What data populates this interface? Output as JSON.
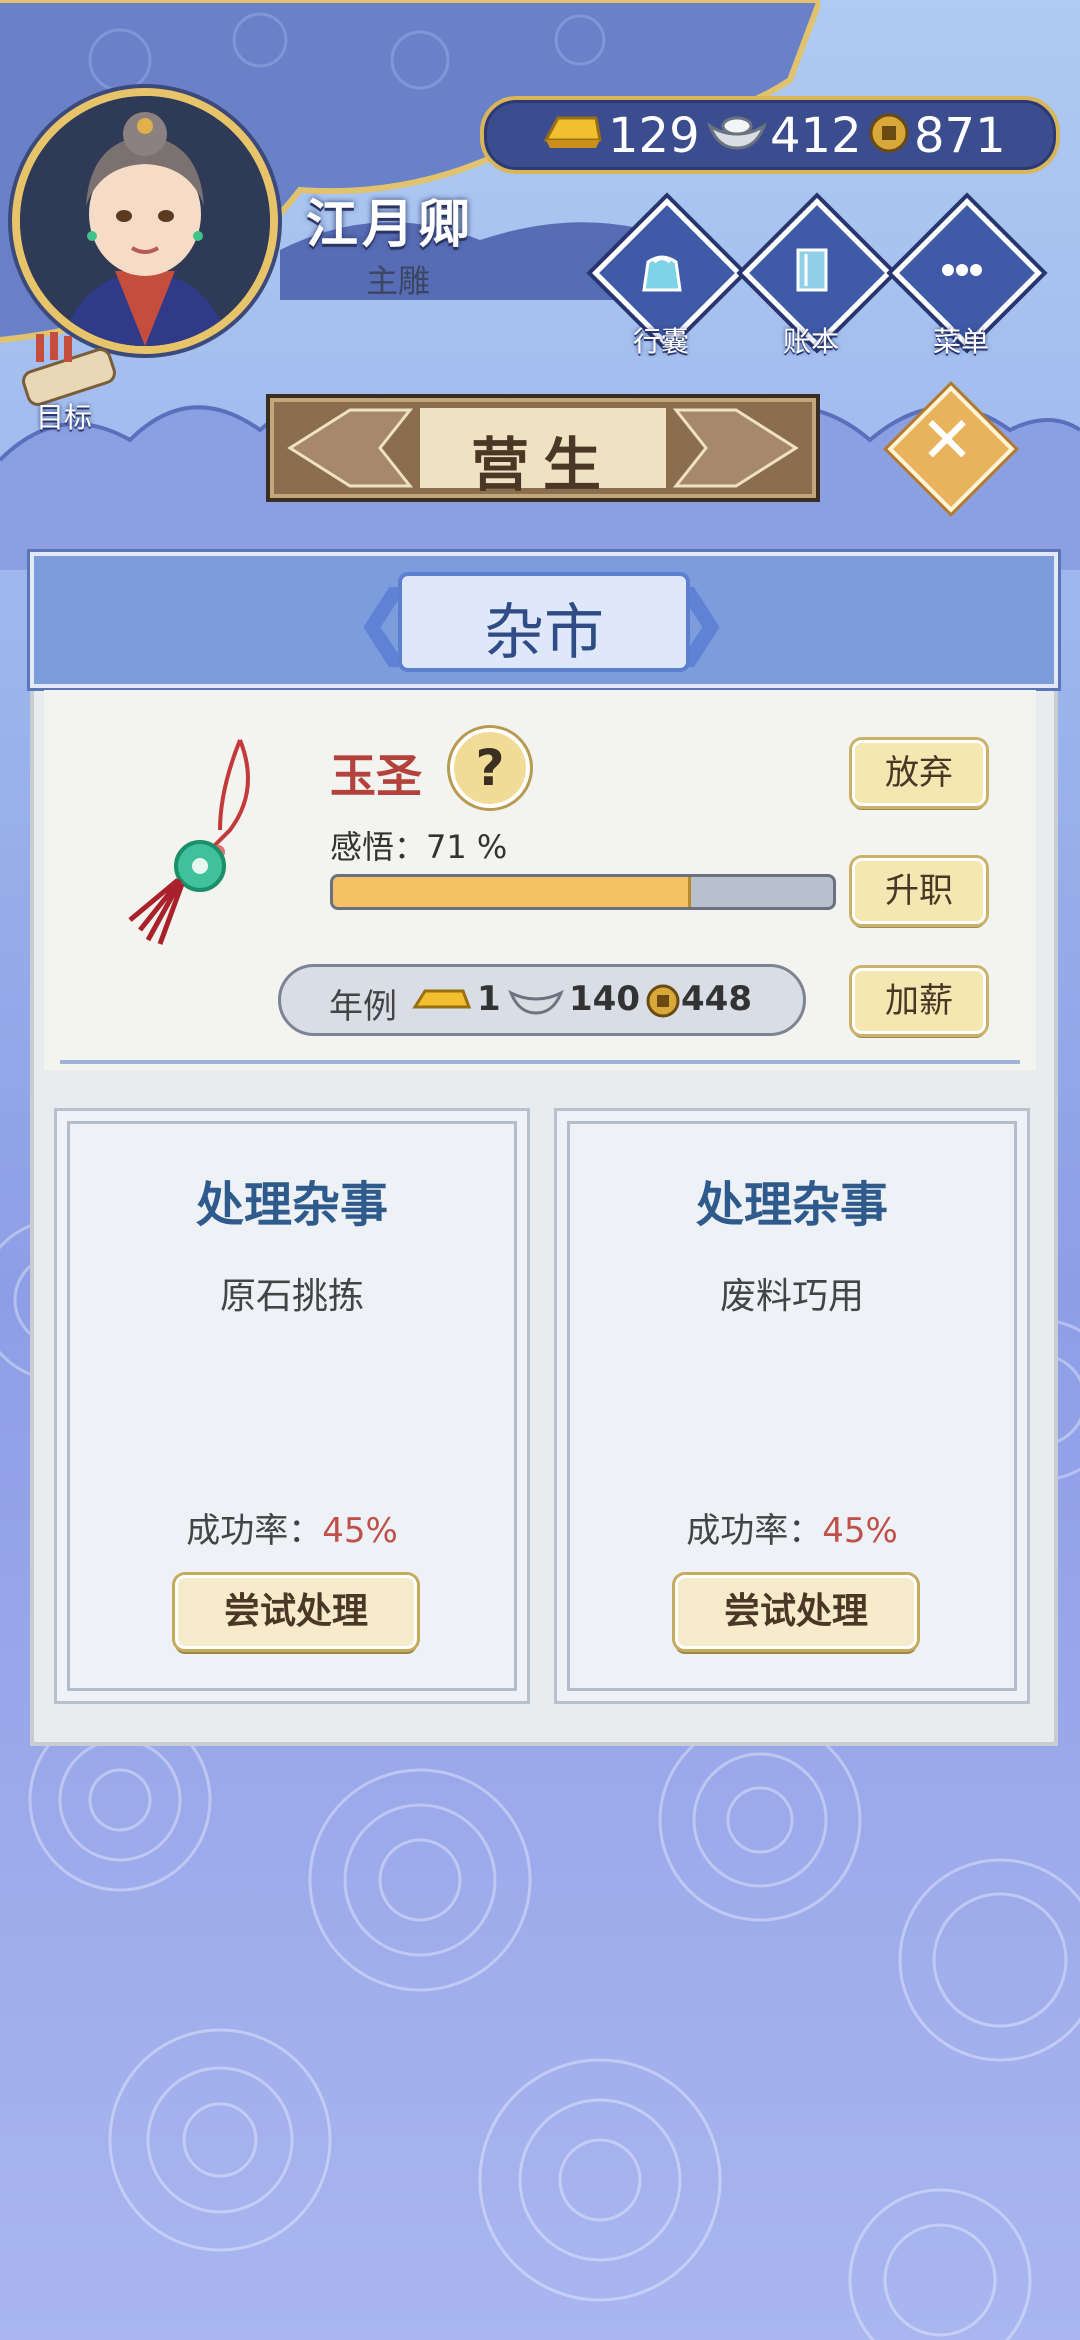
{
  "player": {
    "name": "江月卿",
    "title": "主雕"
  },
  "currency": {
    "gold": "129",
    "silver": "412",
    "coin": "871"
  },
  "top_buttons": [
    {
      "label": "行囊",
      "icon": "bag-icon"
    },
    {
      "label": "账本",
      "icon": "ledger-icon"
    },
    {
      "label": "菜单",
      "icon": "menu-icon"
    }
  ],
  "goal": {
    "label": "目标"
  },
  "page": {
    "title": "营生"
  },
  "panel": {
    "title": "杂市"
  },
  "job": {
    "title": "玉圣",
    "help_symbol": "?",
    "insight_label": "感悟：",
    "insight_value": "71 %",
    "insight_progress": 0.71,
    "salary_label": "年例",
    "salary_gold": "1",
    "salary_silver": "140",
    "salary_coin": "448"
  },
  "actions": {
    "abandon": "放弃",
    "promote": "升职",
    "raise": "加薪"
  },
  "tasks": [
    {
      "title": "处理杂事",
      "subtitle": "原石挑拣",
      "rate_label": "成功率：",
      "rate": "45%",
      "button": "尝试处理"
    },
    {
      "title": "处理杂事",
      "subtitle": "废料巧用",
      "rate_label": "成功率：",
      "rate": "45%",
      "button": "尝试处理"
    }
  ],
  "colors": {
    "accent_blue": "#7d9cdc",
    "job_title_red": "#b3423d",
    "gold": "#e7c46a",
    "progress_fill": "#f4c163"
  }
}
